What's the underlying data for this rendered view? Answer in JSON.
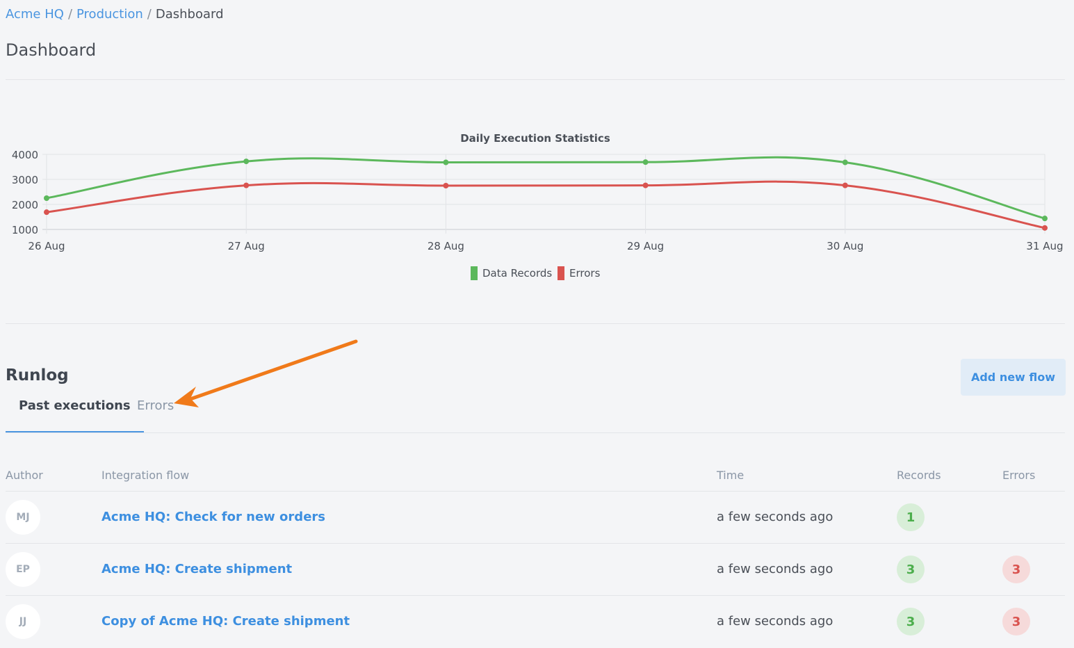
{
  "breadcrumb": {
    "org": "Acme HQ",
    "separator": "/",
    "env": "Production",
    "current": "Dashboard"
  },
  "page_title": "Dashboard",
  "chart_data": {
    "type": "line",
    "title": "Daily Execution Statistics",
    "categories": [
      "26 Aug",
      "27 Aug",
      "28 Aug",
      "29 Aug",
      "30 Aug",
      "31 Aug"
    ],
    "y_ticks": [
      "4000",
      "3000",
      "2000",
      "1000"
    ],
    "ylim": [
      1000,
      4000
    ],
    "grid": true,
    "legend_position": "bottom",
    "series": [
      {
        "name": "Data Records",
        "color": "#5cb85c",
        "values": [
          2250,
          3720,
          3680,
          3690,
          3680,
          1440
        ]
      },
      {
        "name": "Errors",
        "color": "#d9534f",
        "values": [
          1690,
          2760,
          2750,
          2760,
          2760,
          1060
        ]
      }
    ]
  },
  "runlog": {
    "title": "Runlog",
    "add_button": "Add new flow",
    "tabs": [
      {
        "label": "Past executions",
        "active": true
      },
      {
        "label": "Errors",
        "active": false
      }
    ],
    "columns": {
      "author": "Author",
      "flow": "Integration flow",
      "time": "Time",
      "records": "Records",
      "errors": "Errors"
    },
    "rows": [
      {
        "author": "MJ",
        "flow": "Acme HQ: Check for new orders",
        "time": "a few seconds ago",
        "records": "1",
        "errors": ""
      },
      {
        "author": "EP",
        "flow": "Acme HQ: Create shipment",
        "time": "a few seconds ago",
        "records": "3",
        "errors": "3"
      },
      {
        "author": "JJ",
        "flow": "Copy of Acme HQ: Create shipment",
        "time": "a few seconds ago",
        "records": "3",
        "errors": "3"
      }
    ]
  },
  "colors": {
    "accent": "#4a95e0",
    "success": "#5cb85c",
    "danger": "#d9534f",
    "annotation_arrow": "#f07a1a"
  }
}
